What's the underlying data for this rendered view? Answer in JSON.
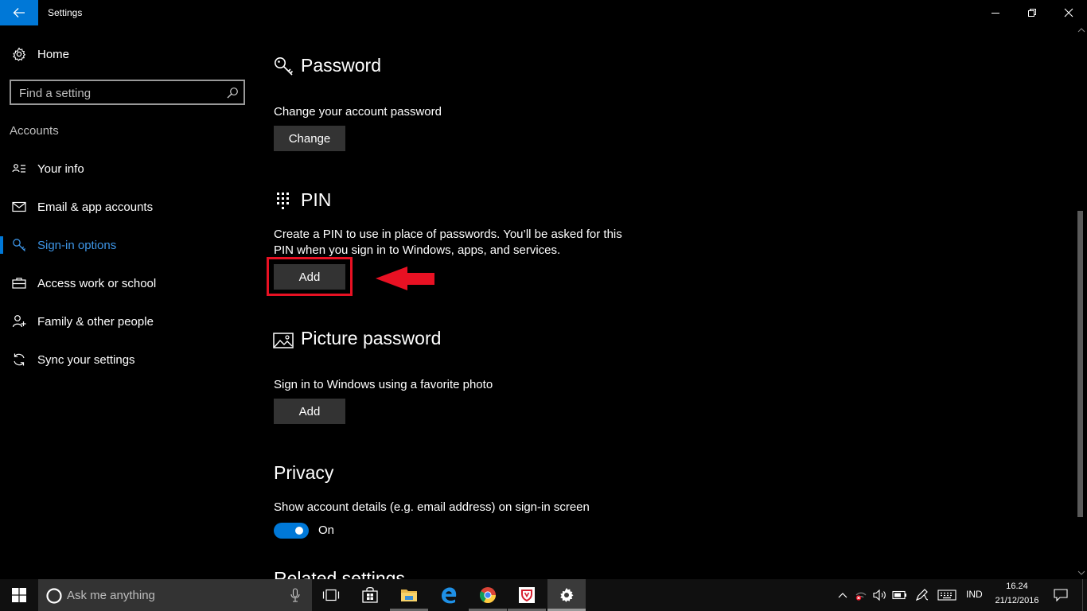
{
  "window": {
    "title": "Settings"
  },
  "sidebar": {
    "home_label": "Home",
    "search_placeholder": "Find a setting",
    "section_header": "Accounts",
    "items": [
      {
        "label": "Your info",
        "icon": "person-card-icon"
      },
      {
        "label": "Email & app accounts",
        "icon": "mail-icon"
      },
      {
        "label": "Sign-in options",
        "icon": "key-icon",
        "active": true
      },
      {
        "label": "Access work or school",
        "icon": "briefcase-icon"
      },
      {
        "label": "Family & other people",
        "icon": "person-add-icon"
      },
      {
        "label": "Sync your settings",
        "icon": "sync-icon"
      }
    ]
  },
  "main": {
    "password": {
      "title": "Password",
      "desc": "Change your account password",
      "button": "Change"
    },
    "pin": {
      "title": "PIN",
      "desc_line1": "Create a PIN to use in place of passwords. You’ll be asked for this",
      "desc_line2": "PIN when you sign in to Windows, apps, and services.",
      "button": "Add"
    },
    "picture_password": {
      "title": "Picture password",
      "desc": "Sign in to Windows using a favorite photo",
      "button": "Add"
    },
    "privacy": {
      "title": "Privacy",
      "desc": "Show account details (e.g. email address) on sign-in screen",
      "toggle_label": "On",
      "toggle_on": true
    },
    "related_settings_title": "Related settings"
  },
  "taskbar": {
    "cortana_placeholder": "Ask me anything",
    "language": "IND",
    "time": "16.24",
    "date": "21/12/2016"
  },
  "colors": {
    "accent": "#0078d7",
    "highlight": "#e81123",
    "active_text": "#3d95e6"
  }
}
